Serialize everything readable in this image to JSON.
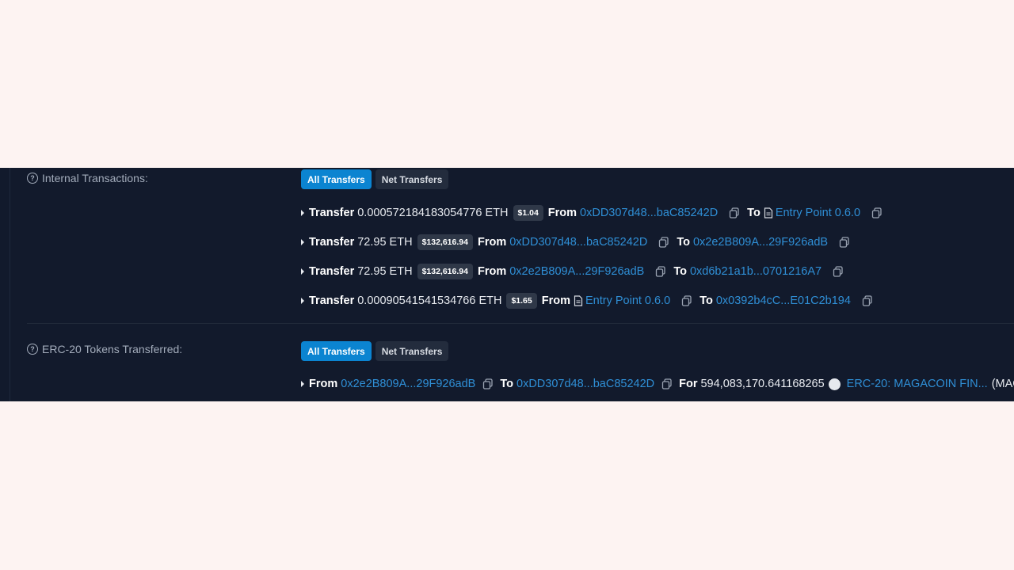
{
  "internal": {
    "label": "Internal Transactions:",
    "tabs": [
      "All Transfers",
      "Net Transfers"
    ],
    "rows": [
      {
        "kw": "Transfer",
        "amount": "0.000572184183054776 ETH",
        "usd": "$1.04",
        "from_kw": "From",
        "from": "0xDD307d48...baC85242D",
        "to_kw": "To",
        "to": "Entry Point 0.6.0"
      },
      {
        "kw": "Transfer",
        "amount": "72.95 ETH",
        "usd": "$132,616.94",
        "from_kw": "From",
        "from": "0xDD307d48...baC85242D",
        "to_kw": "To",
        "to": "0x2e2B809A...29F926adB"
      },
      {
        "kw": "Transfer",
        "amount": "72.95 ETH",
        "usd": "$132,616.94",
        "from_kw": "From",
        "from": "0x2e2B809A...29F926adB",
        "to_kw": "To",
        "to": "0xd6b21a1b...0701216A7"
      },
      {
        "kw": "Transfer",
        "amount": "0.00090541541534766 ETH",
        "usd": "$1.65",
        "from_kw": "From",
        "from": "Entry Point 0.6.0",
        "to_kw": "To",
        "to": "0x0392b4cC...E01C2b194"
      }
    ]
  },
  "erc20": {
    "label": "ERC-20 Tokens Transferred:",
    "tabs": [
      "All Transfers",
      "Net Transfers"
    ],
    "row": {
      "from_kw": "From",
      "from": "0x2e2B809A...29F926adB",
      "to_kw": "To",
      "to": "0xDD307d48...baC85242D",
      "for_kw": "For",
      "amount": "594,083,170.641168265",
      "token": "ERC-20: MAGACOIN FIN...",
      "symbol": "(MAG"
    }
  }
}
